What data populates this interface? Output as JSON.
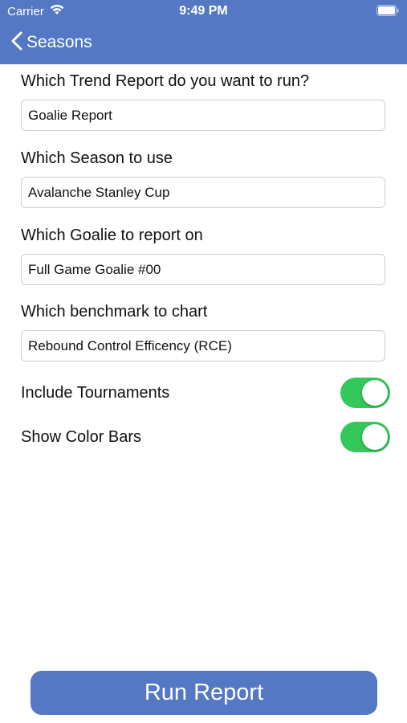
{
  "status_bar": {
    "carrier": "Carrier",
    "time": "9:49 PM",
    "wifi_icon": "wifi-icon",
    "battery_icon": "battery-icon"
  },
  "nav": {
    "back_label": "Seasons",
    "back_icon": "chevron-left-icon",
    "color": "#5478c4"
  },
  "form": {
    "report_question": "Which Trend Report do you want to run?",
    "report_value": "Goalie Report",
    "season_question": "Which Season to use",
    "season_value": "Avalanche Stanley Cup",
    "goalie_question": "Which Goalie to report on",
    "goalie_value": "Full Game Goalie #00",
    "benchmark_question": "Which benchmark to chart",
    "benchmark_value": "Rebound Control Efficency (RCE)"
  },
  "toggles": {
    "tournaments_label": "Include Tournaments",
    "tournaments_on": true,
    "color_bars_label": "Show Color Bars",
    "color_bars_on": true,
    "on_color": "#34c759"
  },
  "footer": {
    "run_label": "Run Report"
  }
}
